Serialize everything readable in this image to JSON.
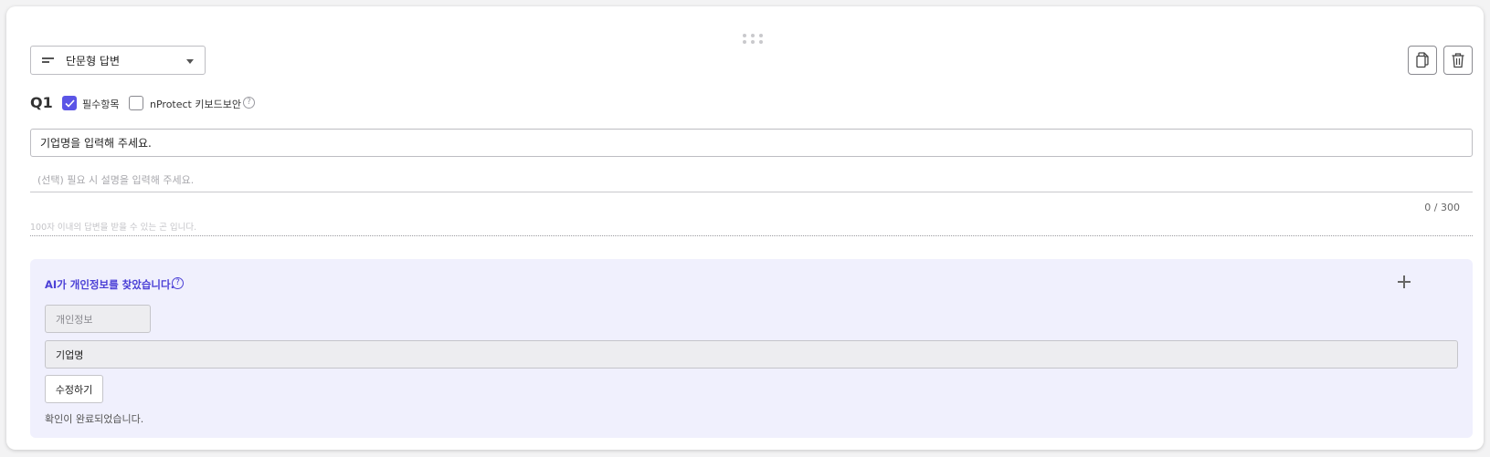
{
  "question": {
    "type_select": {
      "label": "단문형 답변",
      "icon": "short-text-lines-icon"
    },
    "number": "Q1",
    "required": {
      "label": "필수항목",
      "checked": true
    },
    "nprotect": {
      "label": "nProtect 키보드보안",
      "checked": false
    },
    "title_value": "기업명을 입력해 주세요.",
    "description_placeholder": "(선택) 필요 시 설명을 입력해 주세요.",
    "char_counter": "0 / 300",
    "answer_hint": "100자 이내의 답변을 받을 수 있는 곤 입니다.",
    "help_symbol": "?"
  },
  "toolbar": {
    "copy_icon": "copy-icon",
    "delete_icon": "trash-icon",
    "drag_icon": "drag-handle-icon"
  },
  "ai_panel": {
    "title": "AI가 개인정보를 찾았습니다.",
    "help_symbol": "?",
    "tag_label": "개인정보",
    "detected_value": "기업명",
    "edit_label": "수정하기",
    "status": "확인이 완료되었습니다.",
    "accent_color": "#4b40d6",
    "background_color": "#f0f0fd"
  },
  "colors": {
    "checkbox_checked": "#5b55e6"
  }
}
